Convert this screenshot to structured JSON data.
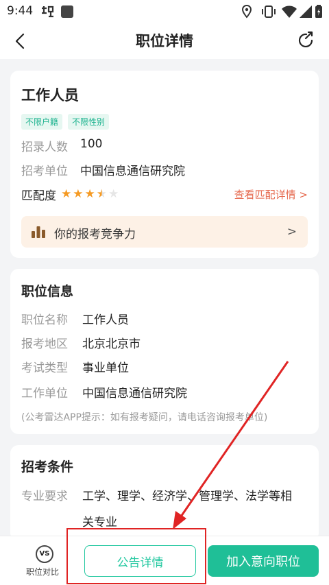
{
  "status_bar": {
    "time": "9:44",
    "left_icons": [
      "notification-icon",
      "app-icon"
    ],
    "right_icons": [
      "location-icon",
      "vibrate-icon",
      "wifi-icon",
      "signal-icon",
      "battery-icon"
    ]
  },
  "header": {
    "title": "职位详情",
    "back_icon": "chevron-left-icon",
    "share_icon": "share-icon"
  },
  "summary": {
    "job_title": "工作人员",
    "tags": [
      "不限户籍",
      "不限性别"
    ],
    "rows": [
      {
        "label": "招录人数",
        "value": "100"
      },
      {
        "label": "招考单位",
        "value": "中国信息通信研究院"
      }
    ],
    "match_label": "匹配度",
    "match_stars": 3.5,
    "match_stars_max": 5,
    "match_link": "查看匹配详情 >",
    "compete_text": "你的报考竞争力",
    "compete_chevron": ">"
  },
  "position_info": {
    "title": "职位信息",
    "rows": [
      {
        "label": "职位名称",
        "value": "工作人员"
      },
      {
        "label": "报考地区",
        "value": "北京北京市"
      },
      {
        "label": "考试类型",
        "value": "事业单位"
      },
      {
        "label": "工作单位",
        "value": "中国信息通信研究院"
      }
    ],
    "tip": "(公考雷达APP提示：如有报考疑问，请电话咨询报考单位)"
  },
  "conditions": {
    "title": "招考条件",
    "major_label": "专业要求",
    "major_value_line1": "工学、理学、经济学、管理学、法学等相",
    "major_value_line2": "关专业"
  },
  "bottom_bar": {
    "compare_icon_text": "VS",
    "compare_label": "职位对比",
    "notice_button": "公告详情",
    "add_button": "加入意向职位"
  },
  "colors": {
    "accent": "#1fbf97",
    "annotation": "#e02424",
    "link": "#e66a4f",
    "star": "#f59a23"
  }
}
